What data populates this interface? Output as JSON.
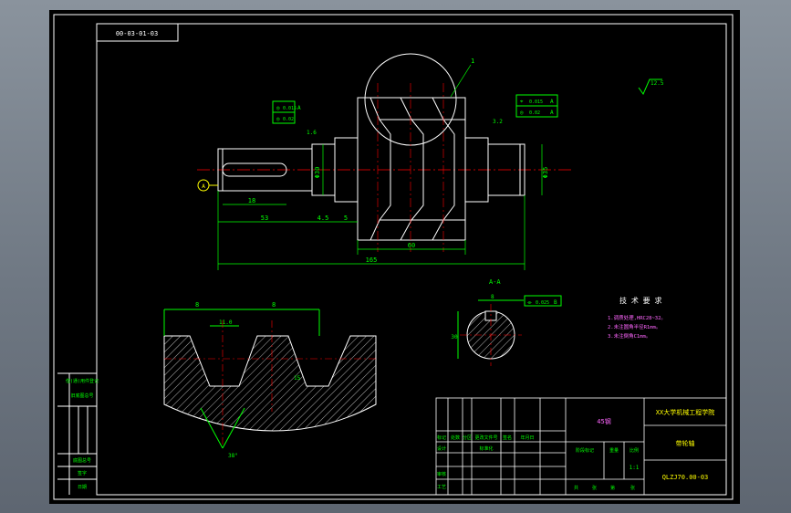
{
  "drawing": {
    "code_box": "00-03-01-03",
    "title_block": {
      "school": "XX大学机械工程学院",
      "part_name": "带轮轴",
      "drawing_no": "QLZJ70.00-03",
      "material": "45钢",
      "header_cells": [
        "标记",
        "处数",
        "分区",
        "更改文件号",
        "签名",
        "年月日"
      ],
      "rows": [
        "设计",
        "审核",
        "工艺"
      ],
      "std_label": "标准化",
      "stage_label": "阶段标记",
      "weight_label": "重量",
      "scale_label": "比例",
      "scale": "1:1",
      "sheet_labels": [
        "共",
        "张",
        "第",
        "张"
      ]
    },
    "left_table": [
      "借(通)用件登记",
      "旧底图总号",
      "底图总号",
      "签字",
      "日期"
    ],
    "tech_req": {
      "title": "技 术 要 求",
      "items": [
        "1.调质处理,HRC28~32。",
        "2.未注圆角半径R1mm。",
        "3.未注倒角C1mm。"
      ]
    },
    "roughness": "12.5",
    "gdt": {
      "left_top": [
        "◎",
        "0.015",
        "A"
      ],
      "left_bottom": [
        "◎",
        "0.02"
      ],
      "right_top": [
        "⌖",
        "0.015",
        "A"
      ],
      "right_bottom": [
        "◎",
        "0.02",
        "A"
      ],
      "section": [
        "⌯",
        "0.025",
        "B"
      ]
    },
    "dims": {
      "key_len": "18",
      "len_a": "53",
      "len_b": "4.5",
      "len_c": "5",
      "mid": "60",
      "overall": "165",
      "dia_left": "Φ30",
      "dia_right": "Φ35",
      "groove_pitch": "15",
      "groove_width": "11.0",
      "groove_angle": "38°",
      "detail_a": "8",
      "detail_b": "8",
      "section_key": "8",
      "section_dia": "30",
      "section_label": "A-A",
      "leader_1": "1",
      "datum": "A",
      "ra_left": "1.6",
      "ra_right": "3.2"
    }
  }
}
